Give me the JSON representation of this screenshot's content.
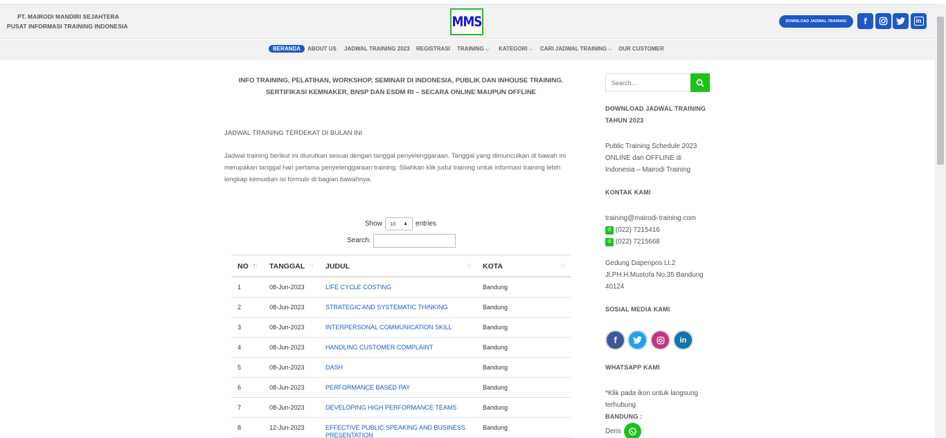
{
  "header": {
    "company_line1": "PT. MAIRODI MANDIRI SEJAHTERA",
    "company_line2": "PUSAT INFORMASI TRAINING INDONESIA",
    "logo_text": "MMS",
    "download_button": "DOWNLOAD JADWAL TRAINING",
    "social": {
      "facebook": "f",
      "instagram": "◎",
      "twitter": "t",
      "linkedin": "in"
    }
  },
  "nav": {
    "beranda": "BERANDA",
    "about": "ABOUT US",
    "jadwal": "JADWAL TRAINING 2023",
    "registrasi": "REGISTRASI",
    "training": "TRAINING",
    "kategori": "KATEGORI",
    "cari": "CARI JADWAL TRAINING",
    "customer": "OUR CUSTOMER"
  },
  "main": {
    "headline1": "INFO TRAINING, PELATIHAN, WORKSHOP, SEMINAR DI INDONESIA, PUBLIK DAN INHOUSE TRAINING.",
    "headline2": "SERTIFIKASI KEMNAKER, BNSP DAN ESDM RI – SECARA ONLINE MAUPUN OFFLINE",
    "subhead": "JADWAL TRAINING TERDEKAT DI BULAN INI",
    "paragraph": "Jadwal training berikut ini diurutkan sesuai dengan tanggal penyelenggaraan. Tanggal yang dimunculkan di bawah ini merupakan tanggal hari pertama penyelenggaraan training. Silahkan klik judul training untuk informasi training lebih lengkap kemudian isi formulir di bagian bawahnya.",
    "show_label": "Show",
    "entries_value": "10",
    "entries_label": "entries",
    "search_label": "Search:",
    "table": {
      "headers": [
        "NO",
        "TANGGAL",
        "JUDUL",
        "KOTA"
      ],
      "rows": [
        {
          "no": "1",
          "date": "08-Jun-2023",
          "title": "LIFE CYCLE COSTING",
          "city": "Bandung"
        },
        {
          "no": "2",
          "date": "08-Jun-2023",
          "title": "STRATEGIC AND SYSTEMATIC THINKING",
          "city": "Bandung"
        },
        {
          "no": "3",
          "date": "08-Jun-2023",
          "title": "INTERPERSONAL COMMUNICATION SKILL",
          "city": "Bandung"
        },
        {
          "no": "4",
          "date": "08-Jun-2023",
          "title": "HANDLING CUSTOMER COMPLAINT",
          "city": "Bandung"
        },
        {
          "no": "5",
          "date": "08-Jun-2023",
          "title": "DASH",
          "city": "Bandung"
        },
        {
          "no": "6",
          "date": "08-Jun-2023",
          "title": "PERFORMANCE BASED PAY",
          "city": "Bandung"
        },
        {
          "no": "7",
          "date": "08-Jun-2023",
          "title": "DEVELOPING HIGH PERFORMANCE TEAMS",
          "city": "Bandung"
        },
        {
          "no": "8",
          "date": "12-Jun-2023",
          "title": "EFFECTIVE PUBLIC SPEAKING AND BUSINESS PRESENTATION",
          "city": "Bandung"
        }
      ]
    }
  },
  "sidebar": {
    "search_placeholder": "Search...",
    "download_title": "DOWNLOAD JADWAL TRAINING TAHUN 2023",
    "download_link": "Public Training Schedule 2023 ONLINE dan OFFLINE di Indonesia – Mairodi Training",
    "contact_title": "KONTAK KAMI",
    "email": "training@mairodi-training.com",
    "phone1": "(022) 7215416",
    "phone2": "(022) 7215668",
    "address": "Gedung Dapenpos Lt.2 Jl.PH.H.Mustofa No.35 Bandung 40124",
    "social_title": "SOSIAL MEDIA KAMI",
    "whatsapp_title": "WHATSAPP KAMI",
    "whatsapp_note": "*Klik pada ikon untuk langsung terhubung",
    "bandung_label": "BANDUNG :",
    "contact_name": "Deris"
  },
  "colors": {
    "accent": "#1e58c6",
    "green": "#1cc21c"
  }
}
